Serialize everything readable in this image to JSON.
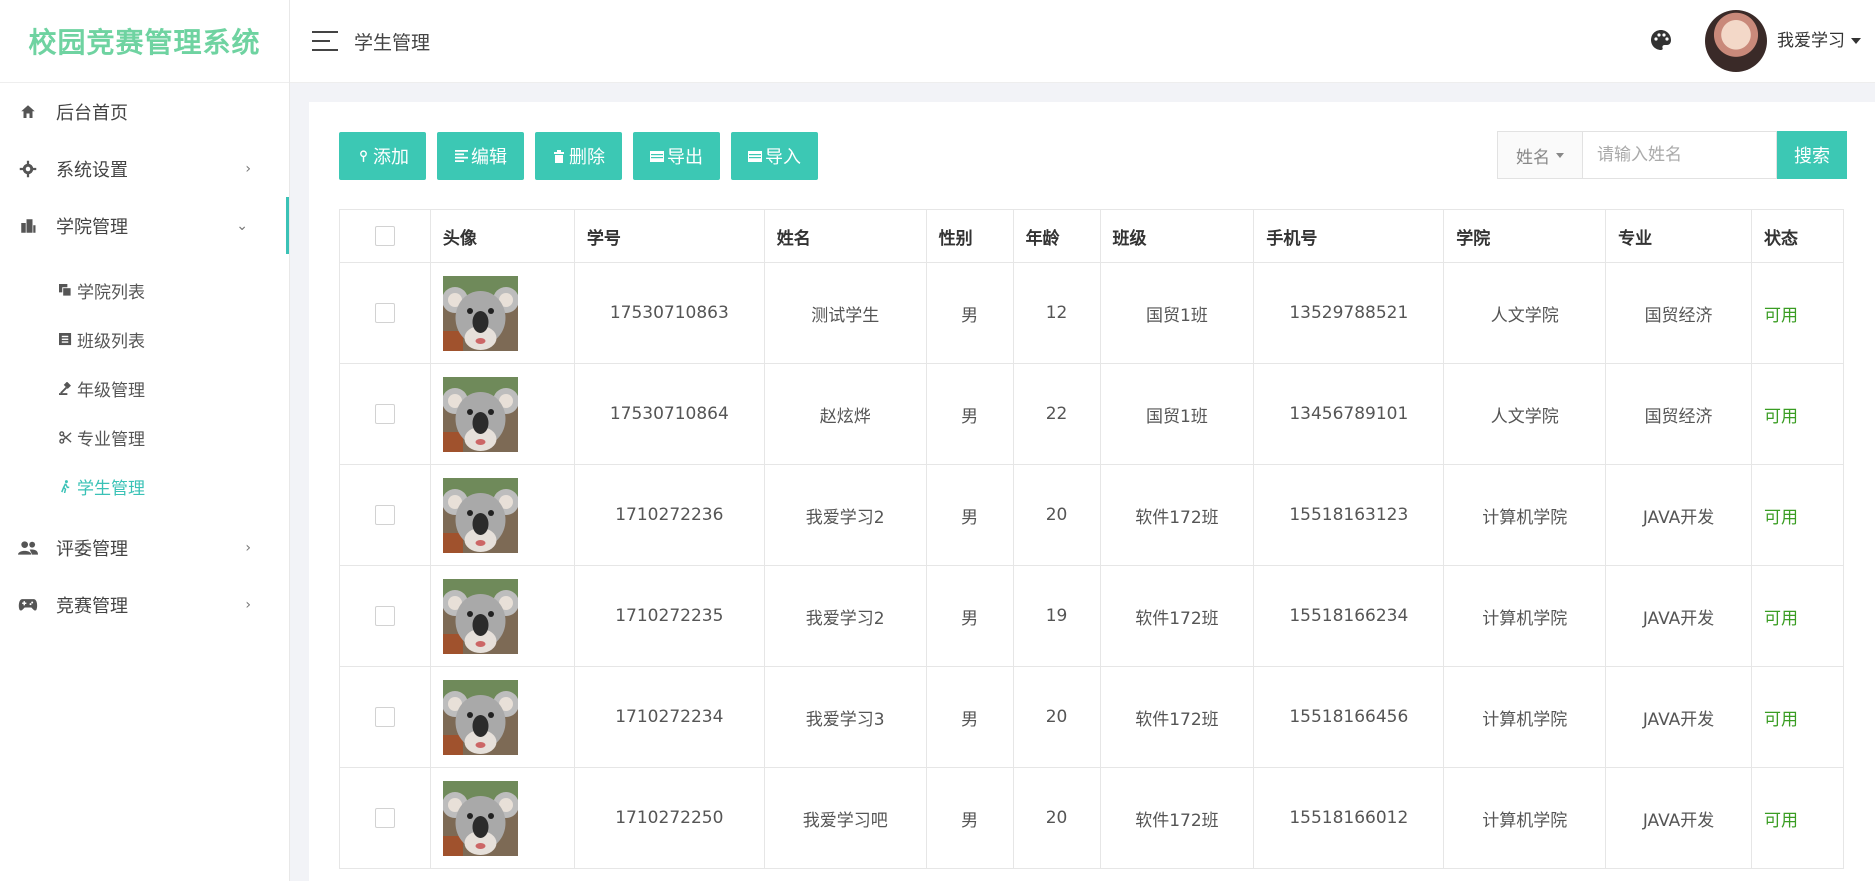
{
  "app": {
    "title": "校园竞赛管理系统"
  },
  "sidebar": {
    "items": [
      {
        "label": "后台首页",
        "icon": "home-icon",
        "has_arrow": false
      },
      {
        "label": "系统设置",
        "icon": "gear-icon",
        "has_arrow": true
      },
      {
        "label": "学院管理",
        "icon": "building-icon",
        "has_arrow": true,
        "open": true,
        "children": [
          {
            "label": "学院列表",
            "icon": "copy-icon"
          },
          {
            "label": "班级列表",
            "icon": "list-icon"
          },
          {
            "label": "年级管理",
            "icon": "gavel-icon"
          },
          {
            "label": "专业管理",
            "icon": "scissors-icon"
          },
          {
            "label": "学生管理",
            "icon": "walk-icon",
            "active": true
          }
        ]
      },
      {
        "label": "评委管理",
        "icon": "users-icon",
        "has_arrow": true
      },
      {
        "label": "竞赛管理",
        "icon": "gamepad-icon",
        "has_arrow": true
      }
    ]
  },
  "header": {
    "title": "学生管理",
    "user_name": "我爱学习"
  },
  "toolbar": {
    "add": "添加",
    "edit": "编辑",
    "delete": "删除",
    "export": "导出",
    "import": "导入"
  },
  "search": {
    "field": "姓名",
    "placeholder": "请输入姓名",
    "button": "搜索"
  },
  "table": {
    "headers": [
      "头像",
      "学号",
      "姓名",
      "性别",
      "年龄",
      "班级",
      "手机号",
      "学院",
      "专业",
      "状态"
    ],
    "rows": [
      {
        "id": "17530710863",
        "name": "测试学生",
        "gender": "男",
        "age": "12",
        "class": "国贸1班",
        "phone": "13529788521",
        "college": "人文学院",
        "major": "国贸经济",
        "status": "可用"
      },
      {
        "id": "17530710864",
        "name": "赵炫烨",
        "gender": "男",
        "age": "22",
        "class": "国贸1班",
        "phone": "13456789101",
        "college": "人文学院",
        "major": "国贸经济",
        "status": "可用"
      },
      {
        "id": "1710272236",
        "name": "我爱学习2",
        "gender": "男",
        "age": "20",
        "class": "软件172班",
        "phone": "15518163123",
        "college": "计算机学院",
        "major": "JAVA开发",
        "status": "可用"
      },
      {
        "id": "1710272235",
        "name": "我爱学习2",
        "gender": "男",
        "age": "19",
        "class": "软件172班",
        "phone": "15518166234",
        "college": "计算机学院",
        "major": "JAVA开发",
        "status": "可用"
      },
      {
        "id": "1710272234",
        "name": "我爱学习3",
        "gender": "男",
        "age": "20",
        "class": "软件172班",
        "phone": "15518166456",
        "college": "计算机学院",
        "major": "JAVA开发",
        "status": "可用"
      },
      {
        "id": "1710272250",
        "name": "我爱学习吧",
        "gender": "男",
        "age": "20",
        "class": "软件172班",
        "phone": "15518166012",
        "college": "计算机学院",
        "major": "JAVA开发",
        "status": "可用"
      }
    ]
  }
}
